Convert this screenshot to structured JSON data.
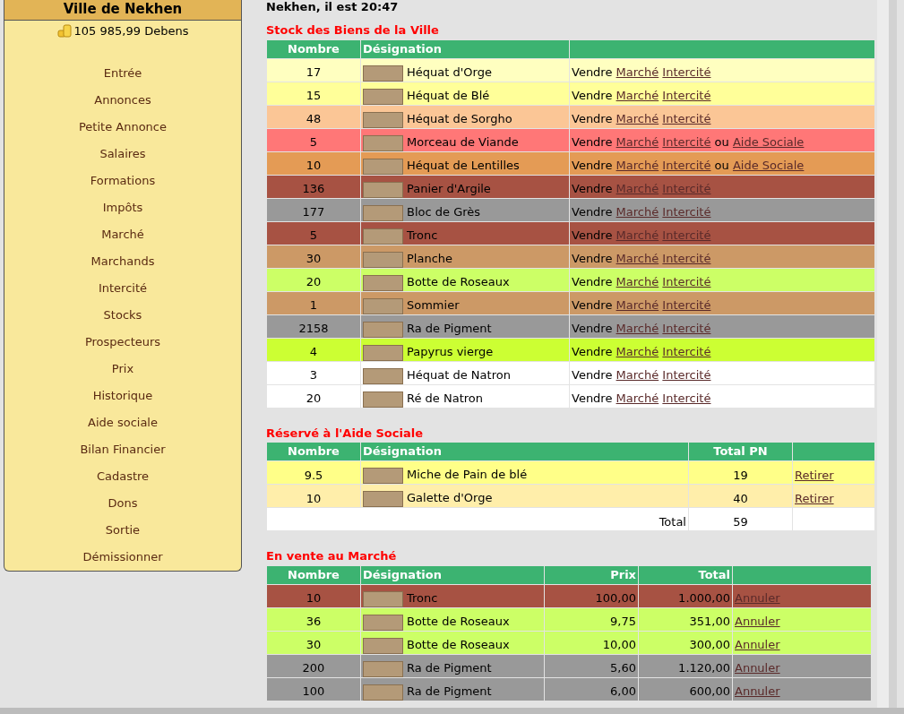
{
  "sidebar": {
    "title": "Ville de Nekhen",
    "balance": "105 985,99 Debens",
    "items": [
      "Entrée",
      "Annonces",
      "Petite Annonce",
      "Salaires",
      "Formations",
      "Impôts",
      "Marché",
      "Marchands",
      "Intercité",
      "Stocks",
      "Prospecteurs",
      "Prix",
      "Historique",
      "Aide sociale",
      "Bilan Financier",
      "Cadastre",
      "Dons",
      "Sortie",
      "Démissionner"
    ]
  },
  "clock": "Nekhen, il est 20:47",
  "stock": {
    "title": "Stock des Biens de la Ville",
    "columns": [
      "Nombre",
      "Désignation"
    ],
    "rows": [
      {
        "count": "17",
        "name": "Héquat d'Orge",
        "color": "#ffffc0",
        "action": "Vendre",
        "links": [
          "Marché",
          "Intercité"
        ]
      },
      {
        "count": "15",
        "name": "Héquat de Blé",
        "color": "#ffff99",
        "action": "Vendre",
        "links": [
          "Marché",
          "Intercité"
        ]
      },
      {
        "count": "48",
        "name": "Héquat de Sorgho",
        "color": "#fbc696",
        "action": "Vendre",
        "links": [
          "Marché",
          "Intercité"
        ]
      },
      {
        "count": "5",
        "name": "Morceau de Viande",
        "color": "#ff7777",
        "action": "Vendre",
        "links": [
          "Marché",
          "Intercité"
        ],
        "extra": {
          "joiner": "ou",
          "link": "Aide Sociale"
        }
      },
      {
        "count": "10",
        "name": "Héquat de Lentilles",
        "color": "#e49b55",
        "action": "Vendre",
        "links": [
          "Marché",
          "Intercité"
        ],
        "extra": {
          "joiner": "ou",
          "link": "Aide Sociale"
        }
      },
      {
        "count": "136",
        "name": "Panier d'Argile",
        "color": "#a75243",
        "action": "Vendre",
        "links": [
          "Marché",
          "Intercité"
        ]
      },
      {
        "count": "177",
        "name": "Bloc de Grès",
        "color": "#999999",
        "action": "Vendre",
        "links": [
          "Marché",
          "Intercité"
        ]
      },
      {
        "count": "5",
        "name": "Tronc",
        "color": "#a75243",
        "action": "Vendre",
        "links": [
          "Marché",
          "Intercité"
        ]
      },
      {
        "count": "30",
        "name": "Planche",
        "color": "#cc9966",
        "action": "Vendre",
        "links": [
          "Marché",
          "Intercité"
        ]
      },
      {
        "count": "20",
        "name": "Botte de Roseaux",
        "color": "#ccff66",
        "action": "Vendre",
        "links": [
          "Marché",
          "Intercité"
        ]
      },
      {
        "count": "1",
        "name": "Sommier",
        "color": "#cc9966",
        "action": "Vendre",
        "links": [
          "Marché",
          "Intercité"
        ]
      },
      {
        "count": "2158",
        "name": "Ra de Pigment",
        "color": "#999999",
        "action": "Vendre",
        "links": [
          "Marché",
          "Intercité"
        ]
      },
      {
        "count": "4",
        "name": "Papyrus vierge",
        "color": "#ccff33",
        "action": "Vendre",
        "links": [
          "Marché",
          "Intercité"
        ]
      },
      {
        "count": "3",
        "name": "Héquat de Natron",
        "color": "#ffffff",
        "action": "Vendre",
        "links": [
          "Marché",
          "Intercité"
        ]
      },
      {
        "count": "20",
        "name": "Ré de Natron",
        "color": "#ffffff",
        "action": "Vendre",
        "links": [
          "Marché",
          "Intercité"
        ]
      }
    ]
  },
  "social": {
    "title": "Réservé à l'Aide Sociale",
    "columns": [
      "Nombre",
      "Désignation",
      "Total PN"
    ],
    "rows": [
      {
        "count": "9.5",
        "name": "Miche de Pain de blé",
        "color": "#ffff88",
        "total": "19",
        "link": "Retirer"
      },
      {
        "count": "10",
        "name": "Galette d'Orge",
        "color": "#ffeeaa",
        "total": "40",
        "link": "Retirer"
      }
    ],
    "total_label": "Total",
    "total": "59"
  },
  "market": {
    "title": "En vente au Marché",
    "columns": [
      "Nombre",
      "Désignation",
      "Prix",
      "Total"
    ],
    "rows": [
      {
        "count": "10",
        "name": "Tronc",
        "color": "#a75243",
        "price": "100,00",
        "total": "1.000,00",
        "link": "Annuler"
      },
      {
        "count": "36",
        "name": "Botte de Roseaux",
        "color": "#ccff66",
        "price": "9,75",
        "total": "351,00",
        "link": "Annuler"
      },
      {
        "count": "30",
        "name": "Botte de Roseaux",
        "color": "#ccff66",
        "price": "10,00",
        "total": "300,00",
        "link": "Annuler"
      },
      {
        "count": "200",
        "name": "Ra de Pigment",
        "color": "#999999",
        "price": "5,60",
        "total": "1.120,00",
        "link": "Annuler"
      },
      {
        "count": "100",
        "name": "Ra de Pigment",
        "color": "#999999",
        "price": "6,00",
        "total": "600,00",
        "link": "Annuler"
      }
    ]
  }
}
